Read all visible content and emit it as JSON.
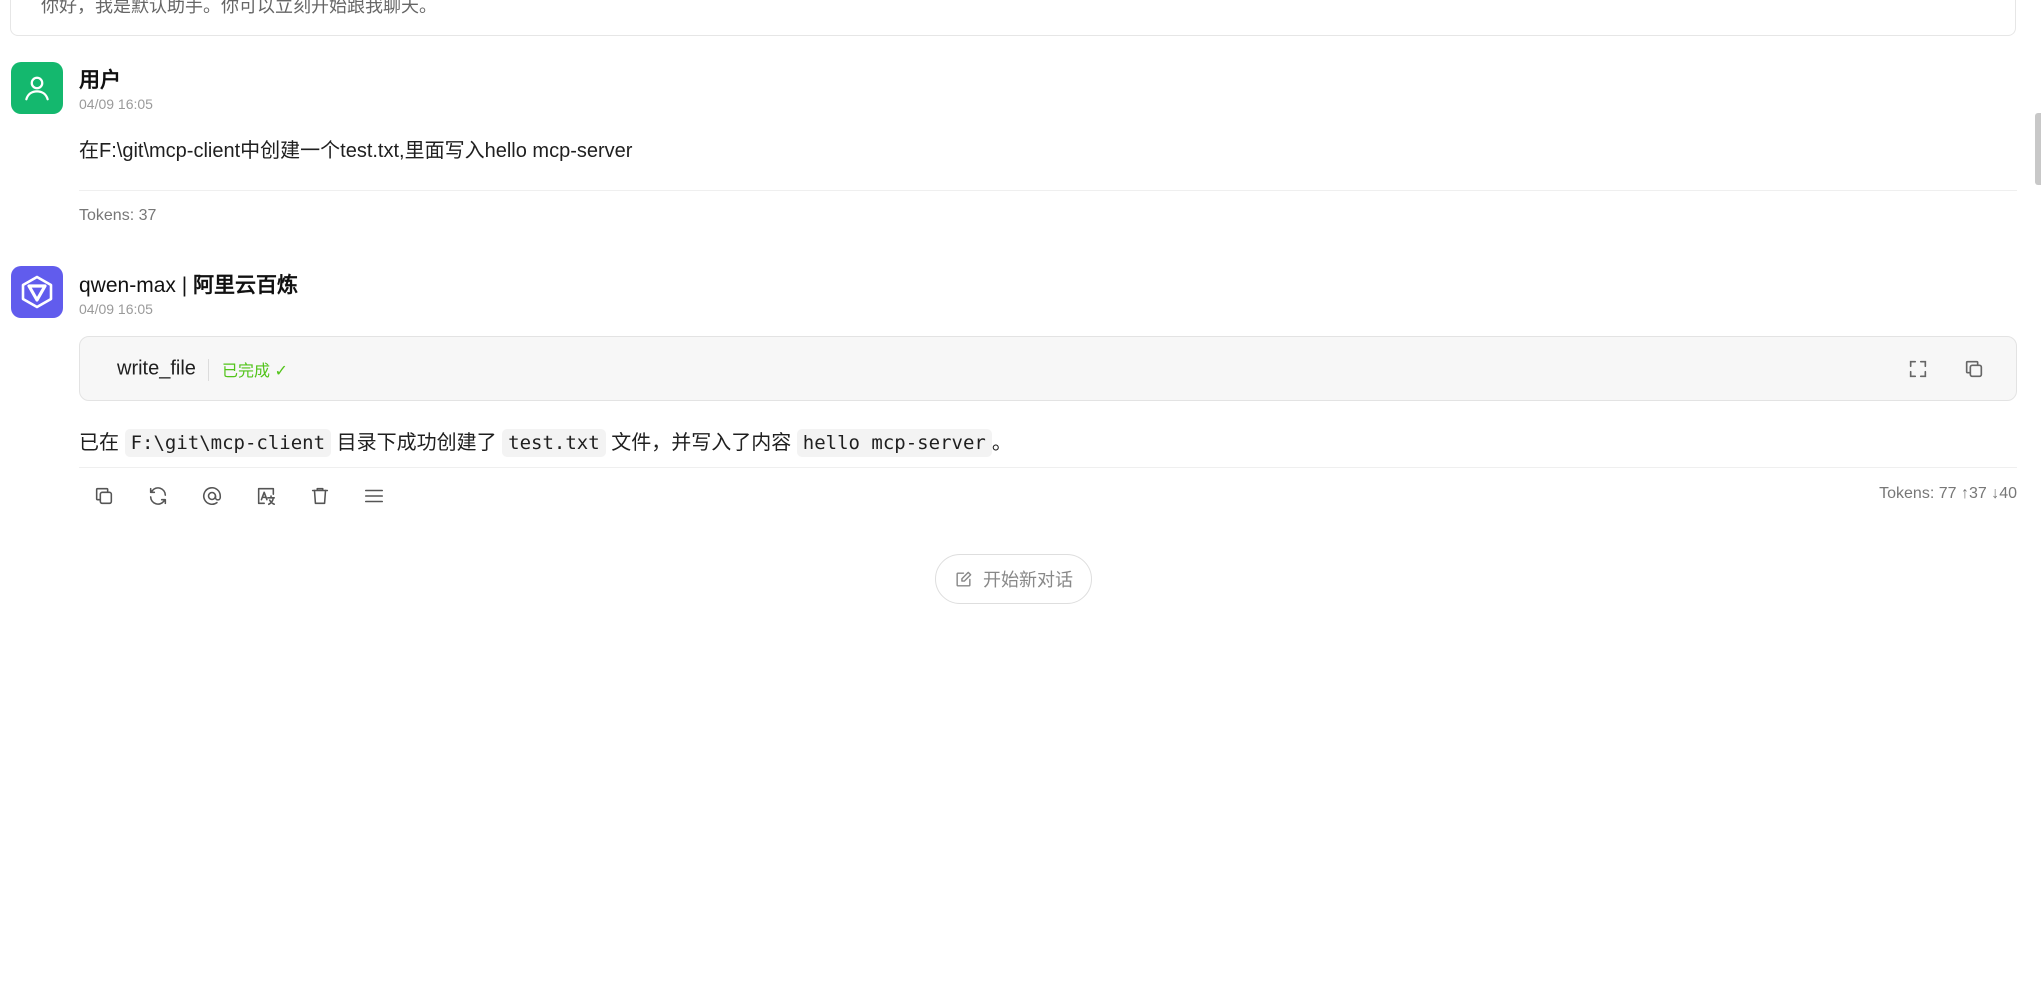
{
  "greeting": {
    "text": "你好，我是默认助手。你可以立刻开始跟我聊天。"
  },
  "user_message": {
    "name": "用户",
    "time": "04/09 16:05",
    "content": "在F:\\git\\mcp-client中创建一个test.txt,里面写入hello mcp-server",
    "tokens": "Tokens: 37",
    "avatar_icon": "user-icon"
  },
  "assistant_message": {
    "model": "qwen-max",
    "separator": " | ",
    "provider": "阿里云百炼",
    "time": "04/09 16:05",
    "avatar_icon": "qwen-logo-icon",
    "tool_call": {
      "name": "write_file",
      "status": "已完成 ✓",
      "expand_icon": "fullscreen-icon",
      "copy_icon": "copy-icon"
    },
    "reply": {
      "t1": "已在",
      "c1": "F:\\git\\mcp-client",
      "t2": "目录下成功创建了",
      "c2": "test.txt",
      "t3": "文件，并写入了内容",
      "c3": "hello mcp-server",
      "t4": "。"
    },
    "tokens": "Tokens: 77 ↑37 ↓40",
    "actions": [
      "copy-icon",
      "regenerate-icon",
      "mention-icon",
      "translate-icon",
      "delete-icon",
      "menu-icon"
    ]
  },
  "new_chat": {
    "label": "开始新对话",
    "icon": "edit-icon"
  },
  "colors": {
    "user_avatar": "#14b86e",
    "bot_avatar": "#615ced",
    "success": "#52c41a"
  }
}
